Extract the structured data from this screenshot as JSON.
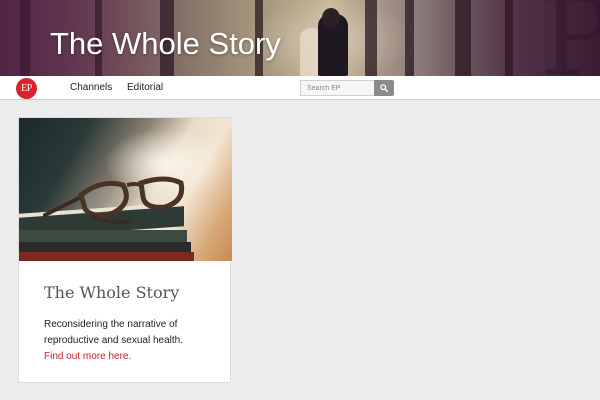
{
  "banner": {
    "title": "The Whole Story"
  },
  "nav": {
    "logo_text": "EP",
    "items": [
      {
        "label": "Channels"
      },
      {
        "label": "Editorial"
      }
    ],
    "search": {
      "placeholder": "Search EP",
      "button_icon": "search-icon"
    }
  },
  "card": {
    "image_subject": "glasses-on-books",
    "title": "The Whole Story",
    "description": "Reconsidering the narrative of reproductive and sexual health.",
    "link_text": "Find out more here."
  },
  "colors": {
    "accent": "#c8202a",
    "logo_bg": "#d8232a",
    "page_bg": "#ececec"
  }
}
